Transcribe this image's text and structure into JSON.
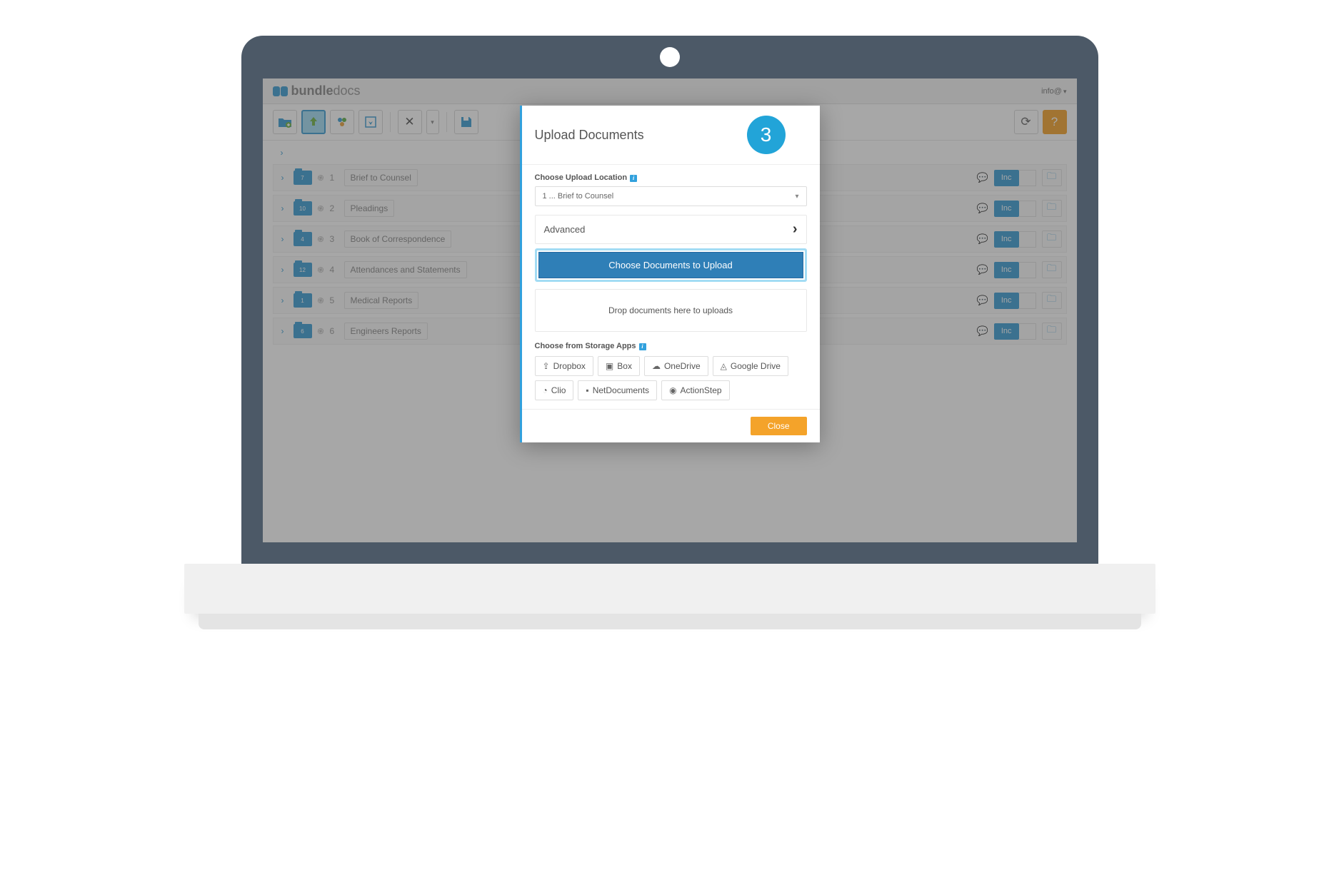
{
  "brand": {
    "prefix": "bundle",
    "suffix": "docs"
  },
  "user_link": "info@",
  "step_number": "3",
  "rows": [
    {
      "num": "1",
      "count": "7",
      "label": "Brief to Counsel"
    },
    {
      "num": "2",
      "count": "10",
      "label": "Pleadings"
    },
    {
      "num": "3",
      "count": "4",
      "label": "Book of Correspondence"
    },
    {
      "num": "4",
      "count": "12",
      "label": "Attendances and Statements"
    },
    {
      "num": "5",
      "count": "1",
      "label": "Medical Reports"
    },
    {
      "num": "6",
      "count": "6",
      "label": "Engineers Reports"
    }
  ],
  "row_action": "Inc",
  "modal": {
    "title": "Upload Documents",
    "location_label": "Choose Upload Location",
    "location_value": "1 ... Brief to Counsel",
    "advanced": "Advanced",
    "choose_btn": "Choose Documents to Upload",
    "drop_text": "Drop documents here to uploads",
    "apps_label": "Choose from Storage Apps",
    "apps": [
      {
        "icon": "⇪",
        "label": "Dropbox"
      },
      {
        "icon": "▣",
        "label": "Box"
      },
      {
        "icon": "☁",
        "label": "OneDrive"
      },
      {
        "icon": "◬",
        "label": "Google Drive"
      },
      {
        "icon": "◔",
        "label": "Clio"
      },
      {
        "icon": "▪",
        "label": "NetDocuments"
      },
      {
        "icon": "◉",
        "label": "ActionStep"
      }
    ],
    "close": "Close"
  }
}
